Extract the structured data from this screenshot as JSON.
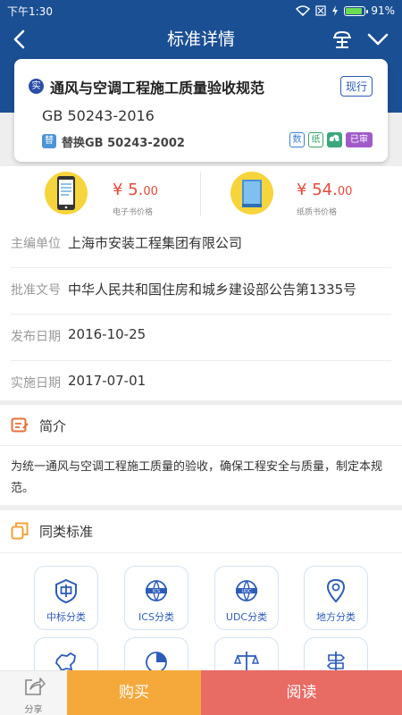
{
  "status_bar": {
    "time": "下午1:30",
    "battery": "91%",
    "battery_level": 0.91
  },
  "header": {
    "title": "标准详情"
  },
  "standard": {
    "type_badge": "实",
    "title": "通风与空调工程施工质量验收规范",
    "status": "现行",
    "code": "GB 50243-2016",
    "replace_badge": "替",
    "replace_text": "替换GB 50243-2002",
    "tags": {
      "digital": "数",
      "paper": "纸",
      "audit": "已审"
    }
  },
  "prices": {
    "ebook": {
      "currency": "¥",
      "integer": "5.",
      "decimal": "00",
      "label": "电子书价格"
    },
    "paper": {
      "currency": "¥",
      "integer": "54.",
      "decimal": "00",
      "label": "纸质书价格"
    }
  },
  "info": [
    {
      "label": "主编单位",
      "value": "上海市安装工程集团有限公司"
    },
    {
      "label": "批准文号",
      "value": "中华人民共和国住房和城乡建设部公告第1335号"
    },
    {
      "label": "发布日期",
      "value": "2016-10-25"
    },
    {
      "label": "实施日期",
      "value": "2017-07-01"
    }
  ],
  "intro": {
    "title": "简介",
    "body": "为统一通风与空调工程施工质量的验收，确保工程安全与质量，制定本规范。"
  },
  "similar": {
    "title": "同类标准",
    "categories": [
      {
        "label": "中标分类",
        "icon": "china-standard-icon"
      },
      {
        "label": "ICS分类",
        "icon": "ics-globe-icon"
      },
      {
        "label": "UDC分类",
        "icon": "udc-globe-icon"
      },
      {
        "label": "地方分类",
        "icon": "map-pin-icon"
      },
      {
        "label": "",
        "icon": "china-map-icon"
      },
      {
        "label": "",
        "icon": "pie-chart-icon"
      },
      {
        "label": "",
        "icon": "scales-icon"
      },
      {
        "label": "",
        "icon": "signpost-icon"
      }
    ]
  },
  "bottom": {
    "share": "分享",
    "buy": "购买",
    "read": "阅读"
  },
  "colors": {
    "primary": "#1b4f93",
    "price": "#e4493b",
    "buy": "#f6a93b",
    "read": "#e86b64"
  }
}
